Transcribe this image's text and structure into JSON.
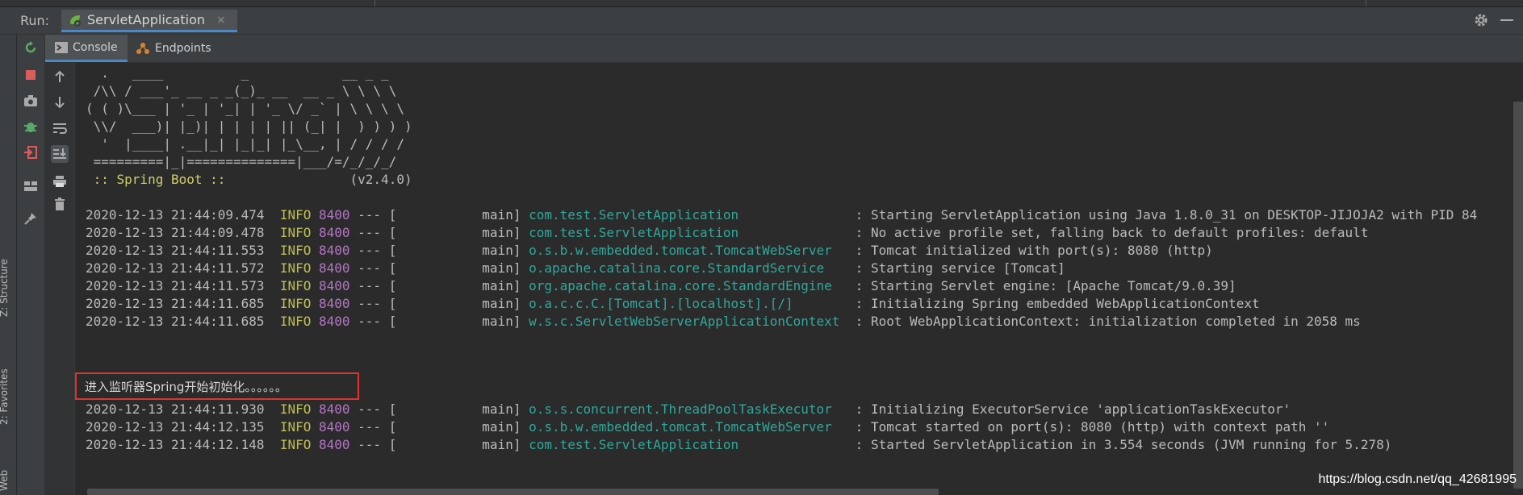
{
  "run_bar": {
    "label": "Run:",
    "tab_title": "ServletApplication",
    "tab_close": "×",
    "tab_icon": "spring-run-icon",
    "settings_icon": "gear-icon",
    "minimize_icon": "minimize-icon"
  },
  "side_labels": {
    "structure": "Z: Structure",
    "favorites": "2: Favorites",
    "web": "Web"
  },
  "sub_tabs": [
    {
      "label": "Console",
      "icon": "console-icon",
      "active": true
    },
    {
      "label": "Endpoints",
      "icon": "endpoints-icon",
      "active": false
    }
  ],
  "action_icons": [
    "rerun-icon",
    "stop-icon",
    "camera-icon",
    "debug-icon",
    "exit-icon",
    "layout-icon",
    "pin-icon"
  ],
  "gutter_icons": [
    "arrow-up-icon",
    "arrow-down-icon",
    "soft-wrap-icon",
    "scroll-to-end-icon",
    "print-icon",
    "trash-icon"
  ],
  "console": {
    "banner": [
      "  .   ____          _            __ _ _",
      " /\\\\ / ___'_ __ _ _(_)_ __  __ _ \\ \\ \\ \\",
      "( ( )\\___ | '_ | '_| | '_ \\/ _` | \\ \\ \\ \\",
      " \\\\/  ___)| |_)| | | | | || (_| |  ) ) ) )",
      "  '  |____| .__|_| |_|_| |_\\__, | / / / /",
      " =========|_|==============|___/=/_/_/_/"
    ],
    "spring_label": " :: Spring Boot :: ",
    "spring_version": "               (v2.4.0)",
    "logs": [
      {
        "ts": "2020-12-13 21:44:09.474",
        "level": "INFO",
        "pid": "8400",
        "sep": " --- [           main] ",
        "cls": "com.test.ServletApplication              ",
        "msg": " : Starting ServletApplication using Java 1.8.0_31 on DESKTOP-JIJOJA2 with PID 84"
      },
      {
        "ts": "2020-12-13 21:44:09.478",
        "level": "INFO",
        "pid": "8400",
        "sep": " --- [           main] ",
        "cls": "com.test.ServletApplication              ",
        "msg": " : No active profile set, falling back to default profiles: default"
      },
      {
        "ts": "2020-12-13 21:44:11.553",
        "level": "INFO",
        "pid": "8400",
        "sep": " --- [           main] ",
        "cls": "o.s.b.w.embedded.tomcat.TomcatWebServer  ",
        "msg": " : Tomcat initialized with port(s): 8080 (http)"
      },
      {
        "ts": "2020-12-13 21:44:11.572",
        "level": "INFO",
        "pid": "8400",
        "sep": " --- [           main] ",
        "cls": "o.apache.catalina.core.StandardService   ",
        "msg": " : Starting service [Tomcat]"
      },
      {
        "ts": "2020-12-13 21:44:11.573",
        "level": "INFO",
        "pid": "8400",
        "sep": " --- [           main] ",
        "cls": "org.apache.catalina.core.StandardEngine  ",
        "msg": " : Starting Servlet engine: [Apache Tomcat/9.0.39]"
      },
      {
        "ts": "2020-12-13 21:44:11.685",
        "level": "INFO",
        "pid": "8400",
        "sep": " --- [           main] ",
        "cls": "o.a.c.c.C.[Tomcat].[localhost].[/]       ",
        "msg": " : Initializing Spring embedded WebApplicationContext"
      },
      {
        "ts": "2020-12-13 21:44:11.685",
        "level": "INFO",
        "pid": "8400",
        "sep": " --- [           main] ",
        "cls": "w.s.c.ServletWebServerApplicationContext ",
        "msg": " : Root WebApplicationContext: initialization completed in 2058 ms"
      }
    ],
    "custom_line": "进入监听器Spring开始初始化。。。。。。",
    "logs2": [
      {
        "ts": "2020-12-13 21:44:11.930",
        "level": "INFO",
        "pid": "8400",
        "sep": " --- [           main] ",
        "cls": "o.s.s.concurrent.ThreadPoolTaskExecutor  ",
        "msg": " : Initializing ExecutorService 'applicationTaskExecutor'"
      },
      {
        "ts": "2020-12-13 21:44:12.135",
        "level": "INFO",
        "pid": "8400",
        "sep": " --- [           main] ",
        "cls": "o.s.b.w.embedded.tomcat.TomcatWebServer  ",
        "msg": " : Tomcat started on port(s): 8080 (http) with context path ''"
      },
      {
        "ts": "2020-12-13 21:44:12.148",
        "level": "INFO",
        "pid": "8400",
        "sep": " --- [           main] ",
        "cls": "com.test.ServletApplication              ",
        "msg": " : Started ServletApplication in 3.554 seconds (JVM running for 5.278)"
      }
    ]
  },
  "watermark": "https://blog.csdn.net/qq_42681995",
  "colors": {
    "background": "#2b2b2b",
    "panel": "#3c3f41",
    "accent_tab": "#4a88c7",
    "log_level": "#bfbf4f",
    "pid": "#b576c7",
    "class": "#2fa89c",
    "highlight_box": "#e0322f"
  }
}
